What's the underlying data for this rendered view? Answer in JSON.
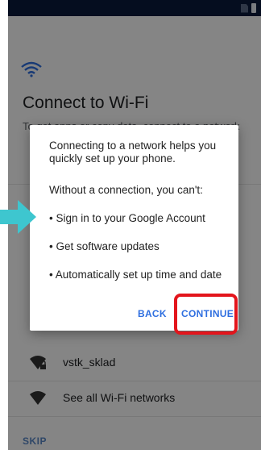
{
  "setup": {
    "title": "Connect to Wi-Fi",
    "subtitle": "To get apps or copy data, connect to a network",
    "networks": [
      {
        "label": "vstk_sklad",
        "icon": "wifi-locked-icon"
      },
      {
        "label": "See all Wi-Fi networks",
        "icon": "wifi-icon"
      }
    ],
    "skip_label": "SKIP"
  },
  "dialog": {
    "intro": "Connecting to a network helps you quickly set up your phone.",
    "without_label": "Without a connection, you can't:",
    "bullets": [
      "• Sign in to your Google Account",
      "• Get software updates",
      "• Automatically set up time and date"
    ],
    "back_label": "BACK",
    "continue_label": "CONTINUE"
  },
  "colors": {
    "status_bar": "#0b1a3d",
    "accent": "#2f6fe0",
    "highlight": "#e3151c",
    "pointer": "#3ec6cf"
  }
}
